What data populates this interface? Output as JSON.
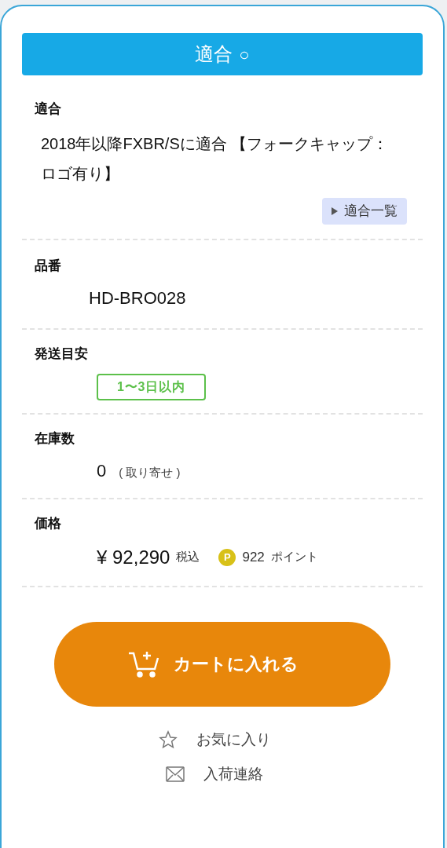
{
  "header": {
    "title": "適合",
    "mark": "○"
  },
  "sections": [
    {
      "kind": "fitment",
      "label": "適合",
      "text": "2018年以降FXBR/Sに適合 【フォークキャップ：ロゴ有り】",
      "link": "適合一覧"
    },
    {
      "kind": "code",
      "label": "品番",
      "value": "HD-BRO028"
    },
    {
      "kind": "badge",
      "label": "発送目安",
      "value": "1〜3日以内",
      "color": "#5cc04a"
    },
    {
      "kind": "stock",
      "label": "在庫数",
      "value": "0",
      "note": "( 取り寄せ )"
    },
    {
      "kind": "price",
      "label": "価格",
      "price": "¥ 92,290",
      "tax": "税込",
      "points": "922",
      "points_unit": "ポイント",
      "points_badge": "P"
    }
  ],
  "cart_button": "カートに入れる",
  "actions": [
    {
      "kind": "favorite",
      "label": "お気に入り"
    },
    {
      "kind": "notify",
      "label": "入荷連絡"
    }
  ]
}
